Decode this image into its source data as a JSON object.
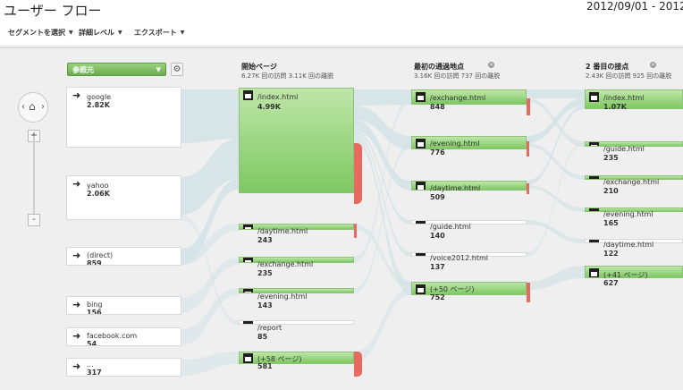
{
  "header": {
    "title": "ユーザー フロー",
    "date_range": "2012/09/01 - 2012/"
  },
  "toolbar": {
    "segment": "セグメントを選択",
    "detail": "詳細レベル",
    "export": "エクスポート"
  },
  "dimension_dropdown": {
    "value": "参照元"
  },
  "columns": [
    {
      "title": "開始ページ",
      "sub": "6.27K 回の訪問 3.11K 回の離脱"
    },
    {
      "title": "最初の通過地点",
      "sub": "3.16K 回の訪問 737 回の離脱"
    },
    {
      "title": "2 番目の接点",
      "sub": "2.43K 回の訪問 925 回の離脱"
    }
  ],
  "sources": [
    {
      "name": "google",
      "value": "2.82K"
    },
    {
      "name": "yahoo",
      "value": "2.06K"
    },
    {
      "name": "(direct)",
      "value": "859"
    },
    {
      "name": "bing",
      "value": "156"
    },
    {
      "name": "facebook.com",
      "value": "54"
    },
    {
      "name": "...",
      "value": "317"
    }
  ],
  "start_pages": [
    {
      "name": "/index.html",
      "value": "4.99K"
    },
    {
      "name": "/daytime.html",
      "value": "243"
    },
    {
      "name": "/exchange.html",
      "value": "235"
    },
    {
      "name": "/evening.html",
      "value": "143"
    },
    {
      "name": "/report",
      "value": "85"
    },
    {
      "name": "(+58 ページ)",
      "value": "581"
    }
  ],
  "first_interaction": [
    {
      "name": "/exchange.html",
      "value": "848"
    },
    {
      "name": "/evening.html",
      "value": "776"
    },
    {
      "name": "/daytime.html",
      "value": "509"
    },
    {
      "name": "/guide.html",
      "value": "140"
    },
    {
      "name": "/voice2012.html",
      "value": "137"
    },
    {
      "name": "(+50 ページ)",
      "value": "752"
    }
  ],
  "second_interaction": [
    {
      "name": "/index.html",
      "value": "1.07K"
    },
    {
      "name": "/guide.html",
      "value": "235"
    },
    {
      "name": "/exchange.html",
      "value": "210"
    },
    {
      "name": "/evening.html",
      "value": "165"
    },
    {
      "name": "/daytime.html",
      "value": "122"
    },
    {
      "name": "(+41 ページ)",
      "value": "627"
    }
  ],
  "colors": {
    "flow": "#d3e3e6",
    "node_green": "#7ec862",
    "dropoff": "#e86a5f"
  }
}
